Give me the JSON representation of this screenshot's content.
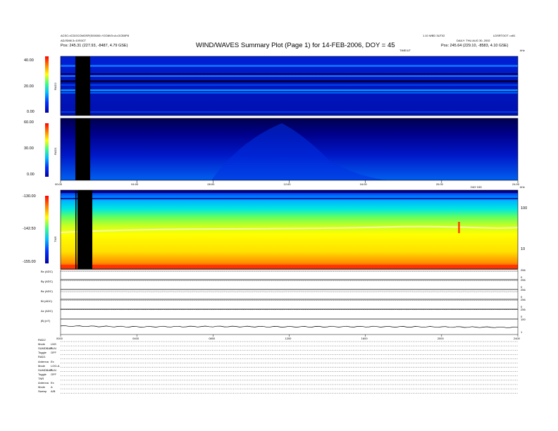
{
  "header": {
    "title": "WIND/WAVES Summary Plot (Page 1) for 14-FEB-2006, DOY = 45",
    "left_line1": "ACSC=ICDOCOMOSP(S00000=Y2O8V0=A=OCB0P8",
    "left_line2": "ADJSM8.3=10S0CT",
    "left_pos_label": "Pos:",
    "left_pos_value": "245.31 (227.93, -8487, 4.79 GSE)",
    "right_line1": "1.10 WBD 3UT02",
    "right_line2": "DAILY: THU AUG 30, 2002",
    "right_corner": "LDSRTOOT =z81",
    "right_pos_label": "Pos:",
    "right_pos_value": "245.64 (229.10, -8583, 4.10 GSE)",
    "timeline_label": "TIME/UT",
    "khz_label": "kHz",
    "khz_label2": "kHz"
  },
  "panels": {
    "rad2": {
      "label": "RAD2",
      "ticks": [
        "40.00",
        "20.00",
        "0.00"
      ]
    },
    "rad1": {
      "label": "RAD1",
      "ticks": [
        "60.00",
        "30.00",
        "0.00"
      ]
    },
    "tnr": {
      "label": "TNR",
      "ticks": [
        "-130.00",
        "-142.50",
        "-155.00"
      ],
      "right_ticks": [
        "100",
        "10"
      ],
      "date_label": "DAY 045"
    },
    "time_axis_mid": [
      "00:00",
      "04:00",
      "08:00",
      "12:00",
      "16:00",
      "20:00",
      "24:00"
    ],
    "time_axis_bottom": [
      "0000",
      "0400",
      "0800",
      "1200",
      "1600",
      "2000",
      "2400"
    ]
  },
  "chart_data": [
    {
      "type": "heatmap",
      "name": "RAD2",
      "x": {
        "range": [
          "00:00",
          "24:00"
        ]
      },
      "y": {
        "ticks": [
          40.0,
          20.0,
          0.0
        ]
      },
      "colorscale": [
        "#0000a0",
        "#0030ff",
        "#00c0ff",
        "#40ff80",
        "#ffff00",
        "#ff8000",
        "#ff0000"
      ],
      "data_gap": {
        "start": "00:50",
        "end": "01:40"
      }
    },
    {
      "type": "heatmap",
      "name": "RAD1",
      "x": {
        "range": [
          "00:00",
          "24:00"
        ]
      },
      "y": {
        "ticks": [
          60.0,
          30.0,
          0.0
        ]
      },
      "colorscale": [
        "#0000a0",
        "#0030ff",
        "#00c0ff",
        "#40ff80",
        "#ffff00",
        "#ff8000",
        "#ff0000"
      ],
      "data_gap": {
        "start": "00:50",
        "end": "01:40"
      }
    },
    {
      "type": "heatmap",
      "name": "TNR",
      "x": {
        "range": [
          "00:00",
          "24:00"
        ]
      },
      "y": {
        "ticks": [
          -130.0,
          -142.5,
          -155.0
        ],
        "right_axis": "log kHz"
      },
      "colorscale": [
        "#0000a0",
        "#0030ff",
        "#00c0ff",
        "#40ff80",
        "#ffff00",
        "#ff8000",
        "#ff0000"
      ],
      "data_gap": {
        "start": "00:50",
        "end": "01:40"
      }
    },
    {
      "type": "line",
      "name": "Bx (ADC)",
      "x": [
        "0000",
        "0400",
        "0800",
        "1200",
        "1600",
        "2000",
        "2400"
      ],
      "y_ticks_right": [
        256,
        0
      ],
      "values": [
        0.82,
        0.83,
        0.82,
        0.82,
        0.83,
        0.82,
        0.82
      ]
    },
    {
      "type": "line",
      "name": "By (ADC)",
      "x": [
        "0000",
        "0400",
        "0800",
        "1200",
        "1600",
        "2000",
        "2400"
      ],
      "y_ticks_right": [
        256,
        0
      ],
      "values": [
        0.9,
        0.9,
        0.9,
        0.9,
        0.9,
        0.9,
        0.9
      ]
    },
    {
      "type": "line",
      "name": "Bz (ADC)",
      "x": [
        "0000",
        "0400",
        "0800",
        "1200",
        "1600",
        "2000",
        "2400"
      ],
      "y_ticks_right": [
        256,
        0
      ],
      "values": [
        0.78,
        0.78,
        0.78,
        0.78,
        0.78,
        0.78,
        0.78
      ]
    },
    {
      "type": "line",
      "name": "Bt (ADC)",
      "x": [
        "0000",
        "0400",
        "0800",
        "1200",
        "1600",
        "2000",
        "2400"
      ],
      "y_ticks_right": [
        256,
        0
      ],
      "values": [
        0.88,
        0.88,
        0.88,
        0.88,
        0.88,
        0.88,
        0.88
      ]
    },
    {
      "type": "line",
      "name": "Az (ADC)",
      "x": [
        "0000",
        "0400",
        "0800",
        "1200",
        "1600",
        "2000",
        "2400"
      ],
      "y_ticks_right": [
        256,
        0
      ],
      "values": [
        0.95,
        0.95,
        0.95,
        0.95,
        0.95,
        0.95,
        0.95
      ]
    },
    {
      "type": "line",
      "name": "|B| (nT)",
      "x": [
        "0000",
        "0400",
        "0800",
        "1200",
        "1600",
        "2000",
        "2400"
      ],
      "y_ticks_right": [
        100,
        10,
        1
      ],
      "values": [
        0.55,
        0.5,
        0.52,
        0.5,
        0.51,
        0.49,
        0.46
      ]
    }
  ],
  "mag_rows": [
    {
      "label": "Bx (ADC)",
      "right_hi": "256",
      "right_lo": "0"
    },
    {
      "label": "By (ADC)",
      "right_hi": "256",
      "right_lo": "0"
    },
    {
      "label": "Bz (ADC)",
      "right_hi": "256",
      "right_lo": "0"
    },
    {
      "label": "Bt (ADC)",
      "right_hi": "256",
      "right_lo": "0"
    },
    {
      "label": "Az (ADC)",
      "right_hi": "256",
      "right_lo": "0"
    },
    {
      "label": "|B| (nT)",
      "right_hi": "100",
      "right_lo": "1"
    }
  ],
  "footer": [
    {
      "key": "RAD2",
      "val": ""
    },
    {
      "key": "Mode",
      "val": "LNS"
    },
    {
      "key": "SUMDBAP",
      "val": "BLN"
    },
    {
      "key": "Toggle",
      "val": "OFF"
    },
    {
      "key": "RAD1",
      "val": ""
    },
    {
      "key": "Antenna",
      "val": "Ex"
    },
    {
      "key": "Mode",
      "val": "LOG-A"
    },
    {
      "key": "SUMDBAP",
      "val": "BLN"
    },
    {
      "key": "Toggle",
      "val": "OFF"
    },
    {
      "key": "TNR",
      "val": ""
    },
    {
      "key": "Antenna",
      "val": "Ex"
    },
    {
      "key": "Mode",
      "val": "A"
    },
    {
      "key": "Sweep",
      "val": "A/B"
    }
  ]
}
